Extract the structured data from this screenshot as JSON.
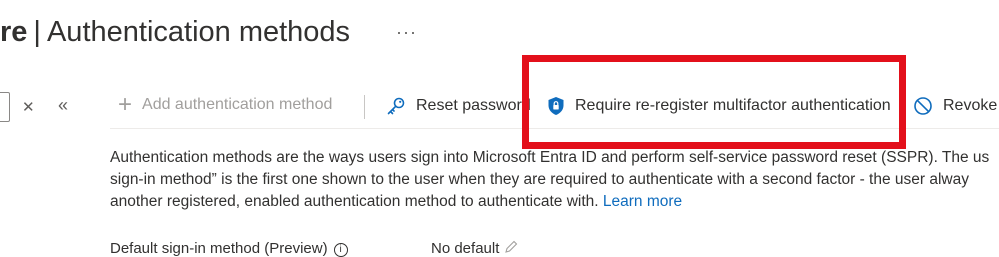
{
  "header": {
    "title_prefix": "re",
    "separator": "|",
    "title": "Authentication methods",
    "more": "···"
  },
  "toolbar": {
    "clear": "✕",
    "collapse": "«",
    "add_label": "Add authentication method",
    "reset_label": "Reset password",
    "require_label": "Require re-register multifactor authentication",
    "revoke_label": "Revoke"
  },
  "description": {
    "line1": "Authentication methods are the ways users sign into Microsoft Entra ID and perform self-service password reset (SSPR). The us",
    "line2": "sign-in method” is the first one shown to the user when they are required to authenticate with a second factor - the user alway",
    "line3": "another registered, enabled authentication method to authenticate with.",
    "link": "Learn more"
  },
  "default_method": {
    "label": "Default sign-in method (Preview)",
    "value": "No default"
  },
  "colors": {
    "highlight": "#e3101b",
    "link": "#0f6cbd",
    "shield": "#0f6cbd"
  }
}
